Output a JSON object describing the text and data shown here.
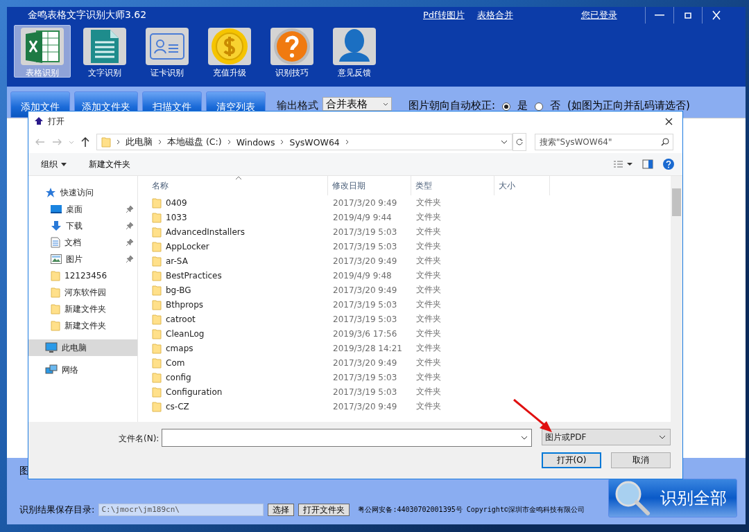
{
  "app": {
    "title": "金鸣表格文字识别大师3.62",
    "links": [
      {
        "label": "Pdf转图片"
      },
      {
        "label": "表格合并"
      },
      {
        "label": "您已登录"
      }
    ],
    "tools": [
      {
        "label": "表格识别",
        "selected": true
      },
      {
        "label": "文字识别",
        "selected": false
      },
      {
        "label": "证卡识别",
        "selected": false
      },
      {
        "label": "充值升级",
        "selected": false
      },
      {
        "label": "识别技巧",
        "selected": false
      },
      {
        "label": "意见反馈",
        "selected": false
      }
    ],
    "buttons": [
      "添加文件",
      "添加文件夹",
      "扫描文件",
      "清空列表"
    ],
    "output_format": {
      "label": "输出格式",
      "value": "合并表格"
    },
    "orientation": {
      "label": "图片朝向自动校正:",
      "options": [
        {
          "label": "是",
          "selected": true
        },
        {
          "label": "否",
          "selected": false
        }
      ],
      "note": "(如图为正向并乱码请选否)"
    },
    "partial_label": "图",
    "save": {
      "label": "识别结果保存目录:",
      "value": "C:\\jmocr\\jm189cn\\",
      "buttons": [
        "选择",
        "打开文件夹"
      ]
    },
    "footer": "粤公网安备:44030702001395号 Copyright©深圳市金鸣科技有限公司",
    "recognize_button": "识别全部"
  },
  "dialog": {
    "title": "打开",
    "breadcrumbs": [
      "此电脑",
      "本地磁盘 (C:)",
      "Windows",
      "SysWOW64"
    ],
    "search": {
      "placeholder": "搜索\"SysWOW64\""
    },
    "commands": [
      {
        "label": "组织",
        "dropdown": true
      },
      {
        "label": "新建文件夹",
        "dropdown": false
      }
    ],
    "nav": [
      {
        "label": "快速访问",
        "pinned": false,
        "selected": false,
        "kind": "header"
      },
      {
        "label": "桌面",
        "pinned": true,
        "selected": false,
        "kind": "item"
      },
      {
        "label": "下载",
        "pinned": true,
        "selected": false,
        "kind": "item"
      },
      {
        "label": "文档",
        "pinned": true,
        "selected": false,
        "kind": "item"
      },
      {
        "label": "图片",
        "pinned": true,
        "selected": false,
        "kind": "item"
      },
      {
        "label": "12123456",
        "pinned": false,
        "selected": false,
        "kind": "item"
      },
      {
        "label": "河东软件园",
        "pinned": false,
        "selected": false,
        "kind": "item"
      },
      {
        "label": "新建文件夹",
        "pinned": false,
        "selected": false,
        "kind": "item"
      },
      {
        "label": "新建文件夹",
        "pinned": false,
        "selected": false,
        "kind": "item"
      },
      {
        "label": "此电脑",
        "pinned": false,
        "selected": true,
        "kind": "header"
      },
      {
        "label": "网络",
        "pinned": false,
        "selected": false,
        "kind": "header"
      }
    ],
    "columns": [
      "名称",
      "修改日期",
      "类型",
      "大小"
    ],
    "rows": [
      {
        "name": "0409",
        "date": "2017/3/20 9:49",
        "type": "文件夹"
      },
      {
        "name": "1033",
        "date": "2019/4/9 9:44",
        "type": "文件夹"
      },
      {
        "name": "AdvancedInstallers",
        "date": "2017/3/19 5:03",
        "type": "文件夹"
      },
      {
        "name": "AppLocker",
        "date": "2017/3/19 5:03",
        "type": "文件夹"
      },
      {
        "name": "ar-SA",
        "date": "2017/3/20 9:49",
        "type": "文件夹"
      },
      {
        "name": "BestPractices",
        "date": "2019/4/9 9:48",
        "type": "文件夹"
      },
      {
        "name": "bg-BG",
        "date": "2017/3/20 9:49",
        "type": "文件夹"
      },
      {
        "name": "Bthprops",
        "date": "2017/3/19 5:03",
        "type": "文件夹"
      },
      {
        "name": "catroot",
        "date": "2017/3/19 5:03",
        "type": "文件夹"
      },
      {
        "name": "CleanLog",
        "date": "2019/3/6 17:56",
        "type": "文件夹"
      },
      {
        "name": "cmaps",
        "date": "2019/3/28 14:21",
        "type": "文件夹"
      },
      {
        "name": "Com",
        "date": "2017/3/20 9:49",
        "type": "文件夹"
      },
      {
        "name": "config",
        "date": "2017/3/19 5:03",
        "type": "文件夹"
      },
      {
        "name": "Configuration",
        "date": "2017/3/19 5:03",
        "type": "文件夹"
      },
      {
        "name": "cs-CZ",
        "date": "2017/3/20 9:49",
        "type": "文件夹"
      }
    ],
    "filename_label": "文件名(N):",
    "file_type": "图片或PDF",
    "buttons": [
      {
        "label": "打开(O)",
        "selected": true
      },
      {
        "label": "取消",
        "selected": false
      }
    ]
  }
}
